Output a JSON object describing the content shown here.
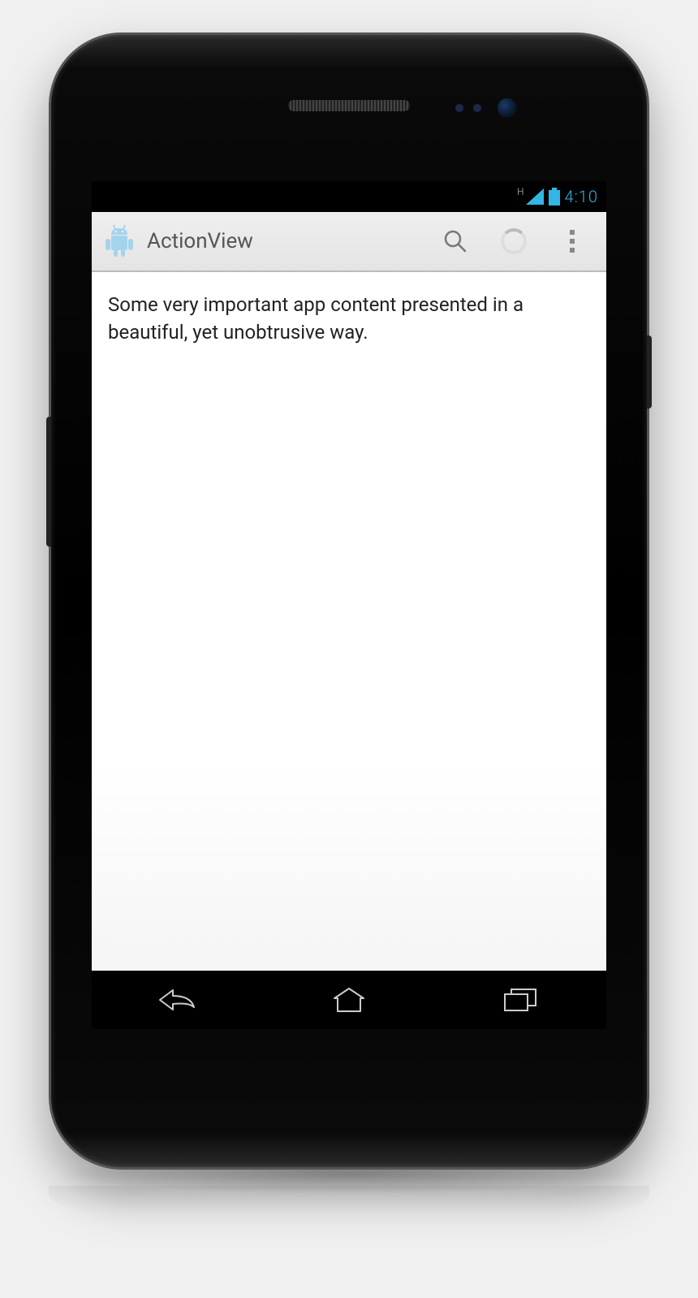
{
  "status": {
    "network_type": "H",
    "time": "4:10",
    "accent": "#33b5e5"
  },
  "actionbar": {
    "title": "ActionView",
    "icons": {
      "app": "android-icon",
      "search": "search-icon",
      "loading": "spinner-icon",
      "overflow": "overflow-icon"
    }
  },
  "content": {
    "body": "Some very important app content presented in a beautiful, yet unobtrusive way."
  },
  "navbar": {
    "back": "back-icon",
    "home": "home-icon",
    "recent": "recent-icon"
  }
}
